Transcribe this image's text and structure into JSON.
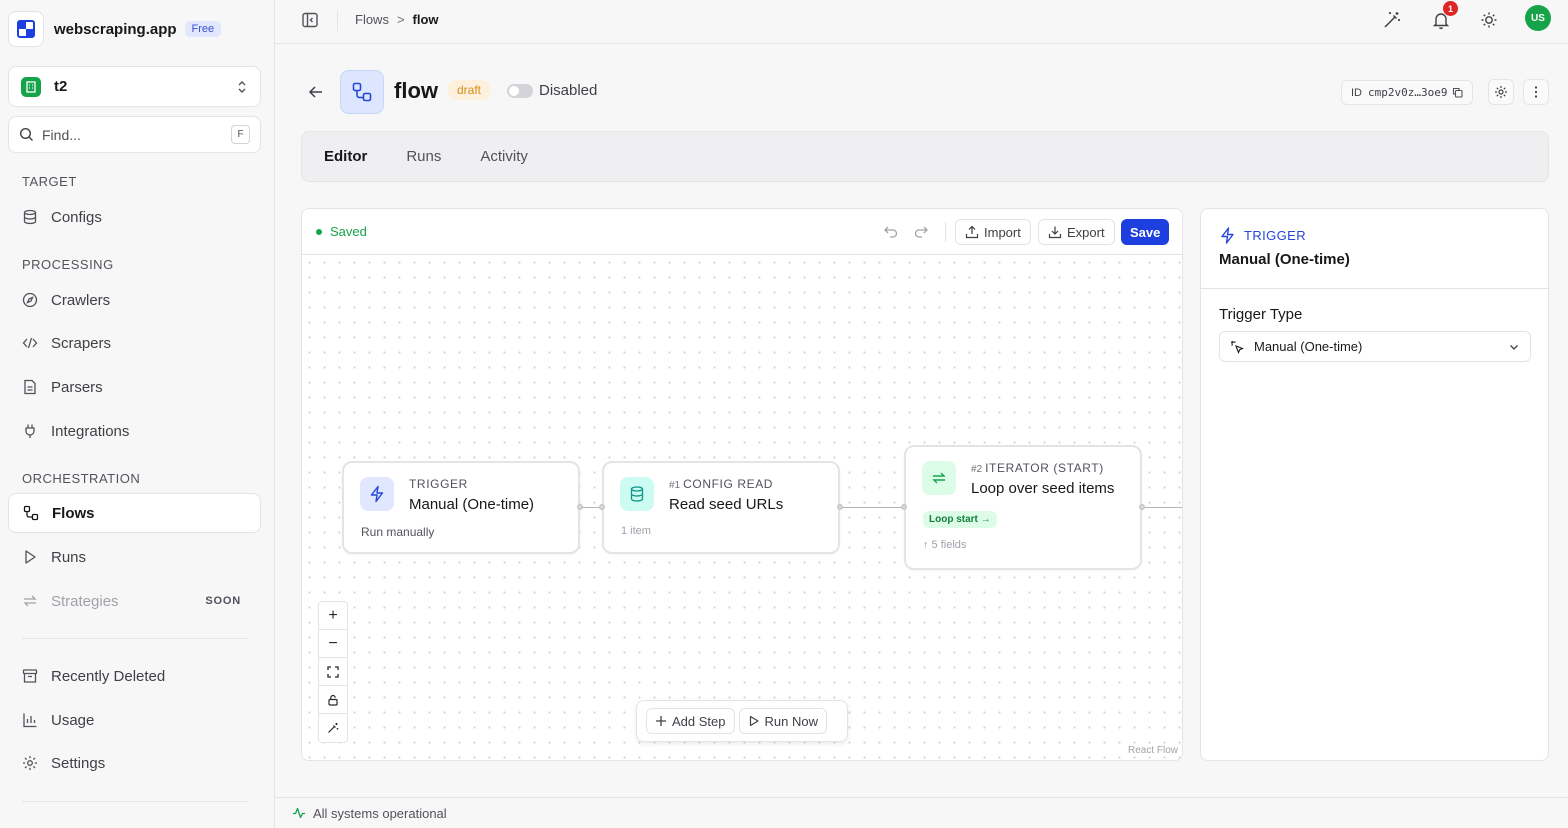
{
  "brand": {
    "name": "webscraping.app",
    "plan": "Free"
  },
  "workspace": {
    "name": "t2"
  },
  "search": {
    "placeholder": "Find...",
    "shortcut": "F"
  },
  "sidebar": {
    "sections": {
      "target": "TARGET",
      "processing": "PROCESSING",
      "orchestration": "ORCHESTRATION"
    },
    "items": {
      "configs": "Configs",
      "crawlers": "Crawlers",
      "scrapers": "Scrapers",
      "parsers": "Parsers",
      "integrations": "Integrations",
      "flows": "Flows",
      "runs": "Runs",
      "strategies": "Strategies",
      "strategies_badge": "SOON",
      "recently_deleted": "Recently Deleted",
      "usage": "Usage",
      "settings": "Settings"
    }
  },
  "topbar": {
    "breadcrumbs": [
      "Flows",
      "flow"
    ],
    "separator": ">",
    "notification_count": "1",
    "avatar_initials": "US"
  },
  "header": {
    "title": "flow",
    "status_badge": "draft",
    "toggle_label": "Disabled",
    "toggle_on": false,
    "id_label": "ID",
    "id_value": "cmp2v0z…3oe9"
  },
  "tabs": [
    "Editor",
    "Runs",
    "Activity"
  ],
  "active_tab": "Editor",
  "canvas": {
    "save_status": "Saved",
    "import_label": "Import",
    "export_label": "Export",
    "save_label": "Save",
    "add_step_label": "Add Step",
    "run_now_label": "Run Now",
    "attribution": "React Flow",
    "controls": [
      "+",
      "−"
    ]
  },
  "nodes": [
    {
      "kind": "TRIGGER",
      "number": "",
      "title": "Manual (One-time)",
      "subtitle": "Run manually",
      "icon": "lightning-icon"
    },
    {
      "kind": "CONFIG READ",
      "number": "#1",
      "title": "Read seed URLs",
      "meta": "1 item",
      "icon": "database-icon"
    },
    {
      "kind": "ITERATOR (START)",
      "number": "#2",
      "title": "Loop over seed items",
      "badge": "Loop start →",
      "meta": "↑ 5 fields",
      "icon": "repeat-icon"
    }
  ],
  "panel": {
    "kind": "TRIGGER",
    "title": "Manual (One-time)",
    "field_label": "Trigger Type",
    "select_value": "Manual (One-time)"
  },
  "status": {
    "text": "All systems operational"
  },
  "colors": {
    "accent": "#1d3fe0",
    "success": "#16a34a",
    "draft": "#d98c1a",
    "danger": "#dc2626"
  }
}
